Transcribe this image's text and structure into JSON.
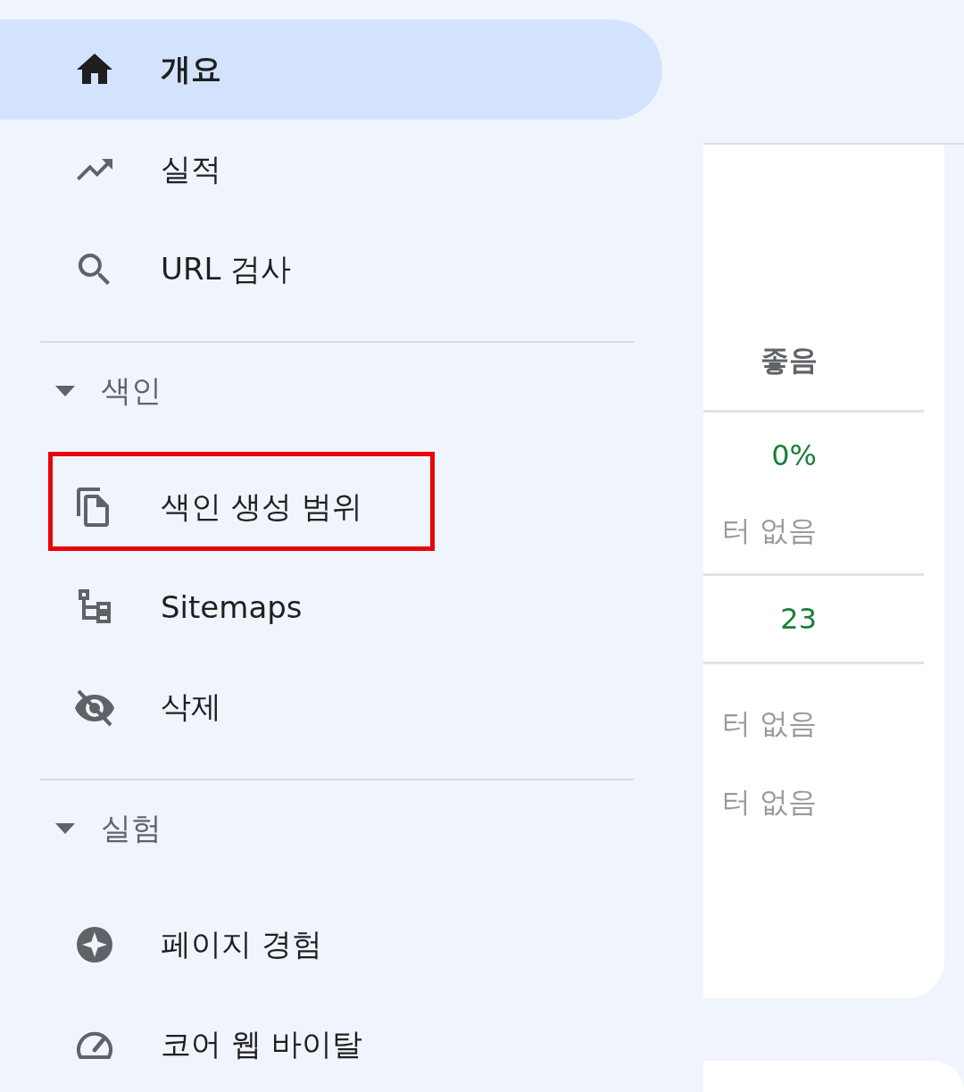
{
  "sidebar": {
    "groups": [
      {
        "items": [
          {
            "label": "개요",
            "kind": "home",
            "selected": true,
            "highlighted": false
          },
          {
            "label": "실적",
            "kind": "trend",
            "selected": false,
            "highlighted": false
          },
          {
            "label": "URL 검사",
            "kind": "search",
            "selected": false,
            "highlighted": false
          }
        ]
      },
      {
        "heading": "색인",
        "expanded": true,
        "items": [
          {
            "label": "색인 생성 범위",
            "kind": "pages",
            "selected": false,
            "highlighted": true
          },
          {
            "label": "Sitemaps",
            "kind": "sitemap",
            "selected": false,
            "highlighted": false
          },
          {
            "label": "삭제",
            "kind": "hidden",
            "selected": false,
            "highlighted": false
          }
        ]
      },
      {
        "heading": "실험",
        "expanded": true,
        "items": [
          {
            "label": "페이지 경험",
            "kind": "star",
            "selected": false,
            "highlighted": false
          },
          {
            "label": "코어 웹 바이탈",
            "kind": "gauge",
            "selected": false,
            "highlighted": false
          }
        ]
      }
    ]
  },
  "table": {
    "column_header": "좋음",
    "row_groups": [
      {
        "cells": [
          {
            "text": "0%",
            "kind": "value"
          },
          {
            "text": "터 없음",
            "kind": "empty"
          }
        ]
      },
      {
        "cells": [
          {
            "text": "23",
            "kind": "value"
          }
        ]
      },
      {
        "cells": [
          {
            "text": "터 없음",
            "kind": "empty"
          },
          {
            "text": "터 없음",
            "kind": "empty"
          }
        ]
      }
    ]
  }
}
